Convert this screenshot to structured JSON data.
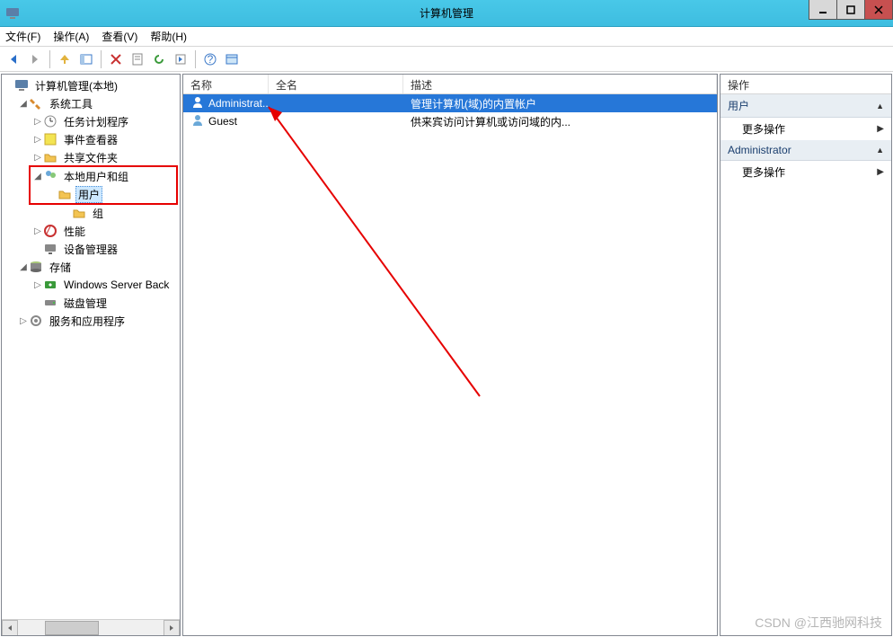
{
  "window": {
    "title": "计算机管理"
  },
  "menubar": {
    "file": "文件(F)",
    "action": "操作(A)",
    "view": "查看(V)",
    "help": "帮助(H)"
  },
  "tree": {
    "root": "计算机管理(本地)",
    "system_tools": "系统工具",
    "task_scheduler": "任务计划程序",
    "event_viewer": "事件查看器",
    "shared_folders": "共享文件夹",
    "local_users_groups": "本地用户和组",
    "users": "用户",
    "groups": "组",
    "performance": "性能",
    "device_manager": "设备管理器",
    "storage": "存储",
    "windows_server_backup": "Windows Server Back",
    "disk_management": "磁盘管理",
    "services_apps": "服务和应用程序"
  },
  "list": {
    "columns": {
      "name": "名称",
      "full_name": "全名",
      "description": "描述"
    },
    "col_widths": {
      "name": 95,
      "full_name": 150,
      "description": 300
    },
    "rows": [
      {
        "name": "Administrat...",
        "full_name": "",
        "description": "管理计算机(域)的内置帐户",
        "selected": true
      },
      {
        "name": "Guest",
        "full_name": "",
        "description": "供来宾访问计算机或访问域的内...",
        "selected": false
      }
    ]
  },
  "actions": {
    "header": "操作",
    "sections": [
      {
        "title": "用户",
        "items": [
          {
            "label": "更多操作"
          }
        ]
      },
      {
        "title": "Administrator",
        "items": [
          {
            "label": "更多操作"
          }
        ]
      }
    ]
  },
  "watermark": "CSDN @江西驰网科技"
}
